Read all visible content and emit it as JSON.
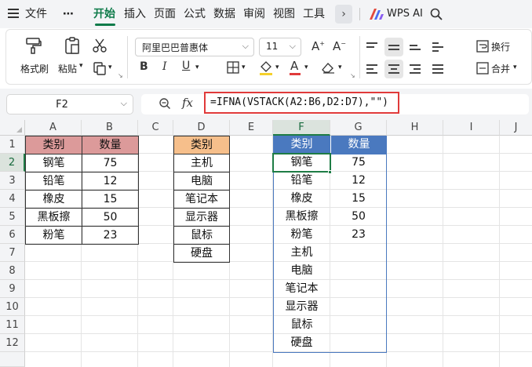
{
  "menu": {
    "file": "文件",
    "more": "⋯",
    "tabs": [
      "开始",
      "插入",
      "页面",
      "公式",
      "数据",
      "审阅",
      "视图",
      "工具"
    ],
    "wps_ai": "WPS AI",
    "next": "›"
  },
  "toolbar": {
    "format_painter": "格式刷",
    "paste": "粘贴",
    "font_name": "阿里巴巴普惠体",
    "font_size": "11",
    "wrap": "换行",
    "merge": "合并"
  },
  "formula_bar": {
    "name_box": "F2",
    "fx": "fx",
    "formula": "=IFNA(VSTACK(A2:B6,D2:D7),\"\")"
  },
  "grid": {
    "columns": [
      "A",
      "B",
      "C",
      "D",
      "E",
      "F",
      "G",
      "H",
      "I",
      "J"
    ],
    "rows": [
      "1",
      "2",
      "3",
      "4",
      "5",
      "6",
      "7",
      "8",
      "9",
      "10",
      "11",
      "12"
    ],
    "table1": {
      "headers": [
        "类别",
        "数量"
      ],
      "rows": [
        [
          "钢笔",
          "75"
        ],
        [
          "铅笔",
          "12"
        ],
        [
          "橡皮",
          "15"
        ],
        [
          "黑板擦",
          "50"
        ],
        [
          "粉笔",
          "23"
        ]
      ]
    },
    "table2": {
      "header": "类别",
      "rows": [
        "主机",
        "电脑",
        "笔记本",
        "显示器",
        "鼠标",
        "硬盘"
      ]
    },
    "result": {
      "headers": [
        "类别",
        "数量"
      ],
      "rows": [
        [
          "钢笔",
          "75"
        ],
        [
          "铅笔",
          "12"
        ],
        [
          "橡皮",
          "15"
        ],
        [
          "黑板擦",
          "50"
        ],
        [
          "粉笔",
          "23"
        ],
        [
          "主机",
          ""
        ],
        [
          "电脑",
          ""
        ],
        [
          "笔记本",
          ""
        ],
        [
          "显示器",
          ""
        ],
        [
          "鼠标",
          ""
        ],
        [
          "硬盘",
          ""
        ]
      ]
    }
  },
  "colors": {
    "accent": "#0f7b4a",
    "pink_header": "#dc9a9a",
    "orange_header": "#f6bf8b",
    "blue_header": "#4a79bf",
    "formula_highlight": "#e03a3a"
  }
}
